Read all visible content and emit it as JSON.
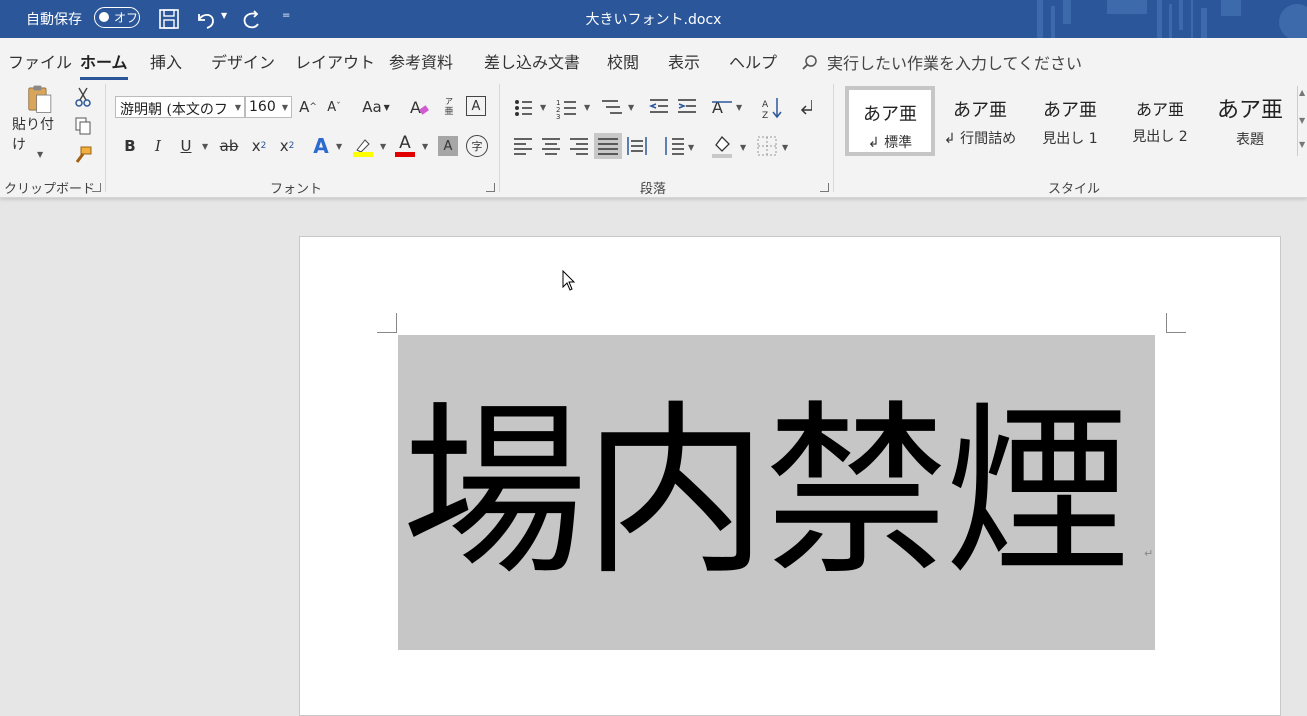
{
  "titlebar": {
    "autosave_label": "自動保存",
    "autosave_state": "オフ",
    "doc_title": "大きいフォント.docx",
    "qat_more": "="
  },
  "tabs": [
    "ファイル",
    "ホーム",
    "挿入",
    "デザイン",
    "レイアウト",
    "参考資料",
    "差し込み文書",
    "校閲",
    "表示",
    "ヘルプ"
  ],
  "tell_me": "実行したい作業を入力してください",
  "clipboard": {
    "paste_label": "貼り付け",
    "group_label": "クリップボード"
  },
  "font": {
    "name": "游明朝 (本文のフ",
    "size": "160",
    "grow": "A",
    "shrink": "A",
    "change_case": "Aa",
    "ruby": "亜",
    "border_char": "A",
    "bold": "B",
    "italic": "I",
    "underline": "U",
    "strike": "ab",
    "subscript": "x",
    "superscript": "x",
    "effects": "A",
    "font_color": "A",
    "shading": "A",
    "enclose": "字",
    "group_label": "フォント",
    "highlight_color": "#ffff00",
    "font_color_value": "#e00000"
  },
  "paragraph": {
    "group_label": "段落"
  },
  "styles": {
    "group_label": "スタイル",
    "items": [
      {
        "sample": "あア亜",
        "name": "↲ 標準"
      },
      {
        "sample": "あア亜",
        "name": "↲ 行間詰め"
      },
      {
        "sample": "あア亜",
        "name": "見出し 1"
      },
      {
        "sample": "あア亜",
        "name": "見出し 2"
      },
      {
        "sample": "あア亜",
        "name": "表題"
      }
    ]
  },
  "document": {
    "text": "場内禁煙",
    "para_mark": "↵"
  },
  "colors": {
    "titlebar": "#2b579a",
    "accent": "#2b579a",
    "selection": "#c6c6c6"
  }
}
